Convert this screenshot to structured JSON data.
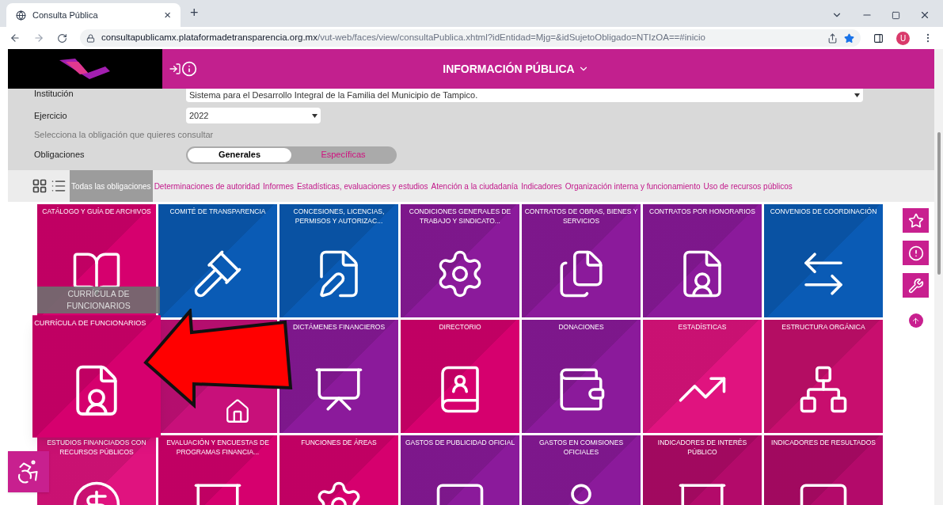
{
  "browser": {
    "tab_title": "Consulta Pública",
    "tab_close": "×",
    "new_tab": "+",
    "url_host": "consultapublicamx.plataformadetransparencia.org.mx",
    "url_path": "/vut-web/faces/view/consultaPublica.xhtml?idEntidad=Mjg=&idSujetoObligado=NTIzOA==#inicio",
    "profile": "U"
  },
  "header": {
    "title": "INFORMACIÓN PÚBLICA"
  },
  "filters": {
    "institution_label": "Institución",
    "institution_value": "Sistema para el Desarrollo Integral de la Familia del Municipio de Tampico.",
    "year_label": "Ejercicio",
    "year_value": "2022",
    "hint": "Selecciona la obligación que quieres consultar",
    "obligations_label": "Obligaciones",
    "toggle": [
      {
        "label": "Generales",
        "selected": true
      },
      {
        "label": "Específicas",
        "selected": false
      }
    ]
  },
  "categories": [
    {
      "label": "Todas las obligaciones",
      "selected": true
    },
    {
      "label": "Determinaciones de autoridad",
      "selected": false
    },
    {
      "label": "Informes",
      "selected": false
    },
    {
      "label": "Estadísticas, evaluaciones y estudios",
      "selected": false
    },
    {
      "label": "Atención a la ciudadanía",
      "selected": false
    },
    {
      "label": "Indicadores",
      "selected": false
    },
    {
      "label": "Organización interna y funcionamiento",
      "selected": false
    },
    {
      "label": "Uso de recursos públicos",
      "selected": false
    }
  ],
  "tiles": [
    {
      "title": "CATÁLOGO Y GUÍA DE ARCHIVOS",
      "color": "#d6006e",
      "highlighted": false
    },
    {
      "title": "COMITÉ DE TRANSPARENCIA",
      "color": "#0a5bb5",
      "highlighted": false
    },
    {
      "title": "CONCESIONES, LICENCIAS, PERMISOS Y AUTORIZAC...",
      "color": "#0a5bb5",
      "highlighted": false
    },
    {
      "title": "CONDICIONES GENERALES DE TRABAJO Y SINDICATO...",
      "color": "#8b1a9b",
      "highlighted": false
    },
    {
      "title": "CONTRATOS DE OBRAS, BIENES Y SERVICIOS",
      "color": "#8b1a9b",
      "highlighted": false
    },
    {
      "title": "CONTRATOS POR HONORARIOS",
      "color": "#8b1a9b",
      "highlighted": false
    },
    {
      "title": "CONVENIOS DE COORDINACIÓN",
      "color": "#0a5bb5",
      "highlighted": false
    },
    {
      "title": "CURRÍCULA DE FUNCIONARIOS",
      "color": "#d6006e",
      "highlighted": true
    },
    {
      "color": "#c8107a",
      "highlighted": false
    },
    {
      "title": "DICTÁMENES FINANCIEROS",
      "color": "#8b1a9b",
      "highlighted": false
    },
    {
      "title": "DIRECTORIO",
      "color": "#d6006e",
      "highlighted": false
    },
    {
      "title": "DONACIONES",
      "color": "#8b1a9b",
      "highlighted": false
    },
    {
      "title": "ESTADÍSTICAS",
      "color": "#e0137f",
      "highlighted": false
    },
    {
      "title": "ESTRUCTURA ORGÁNICA",
      "color": "#c80e6e",
      "highlighted": false
    },
    {
      "title": "ESTUDIOS FINANCIADOS CON RECURSOS PÚBLICOS",
      "color": "#e0137f",
      "highlighted": false
    },
    {
      "title": "EVALUACIÓN Y ENCUESTAS DE PROGRAMAS FINANCIA...",
      "color": "#d6006e",
      "highlighted": false
    },
    {
      "title": "FUNCIONES DE ÁREAS",
      "color": "#d6006e",
      "highlighted": false
    },
    {
      "title": "GASTOS DE PUBLICIDAD OFICIAL",
      "color": "#8b1a9b",
      "highlighted": false
    },
    {
      "title": "GASTOS EN COMISIONES OFICIALES",
      "color": "#8b1a9b",
      "highlighted": false
    },
    {
      "title": "INDICADORES DE INTERÉS PÚBLICO",
      "color": "#b30a6a",
      "highlighted": false
    },
    {
      "title": "INDICADORES DE RESULTADOS",
      "color": "#b30a6a",
      "highlighted": false
    }
  ],
  "tooltip": {
    "text": "CURRÍCULA DE FUNCIONARIOS"
  }
}
